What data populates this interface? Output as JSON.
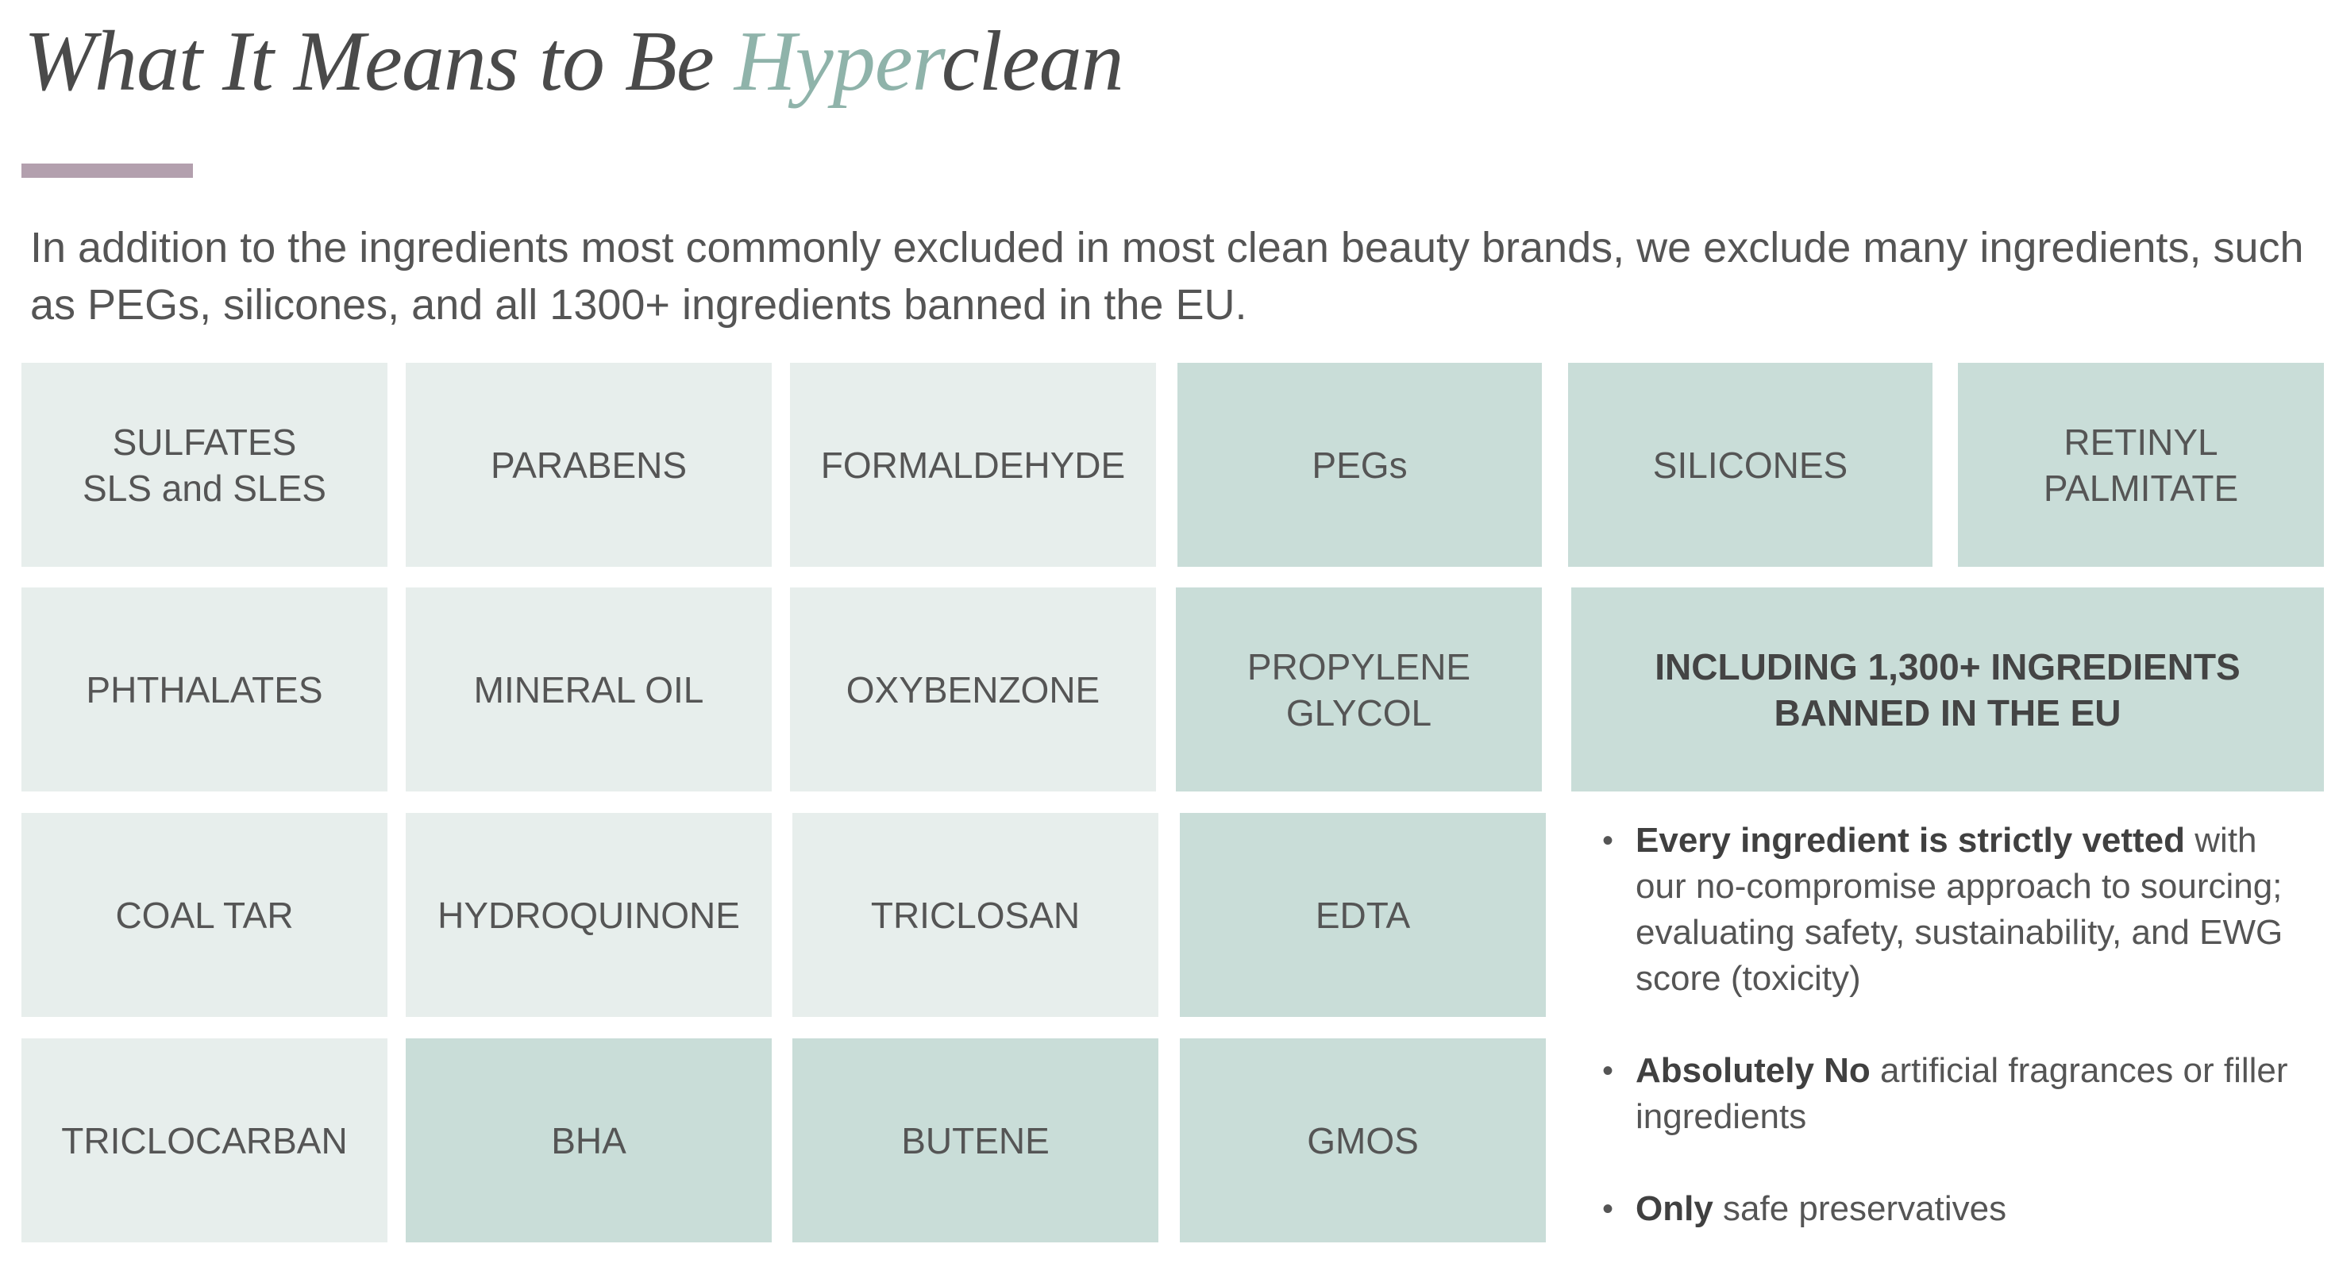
{
  "title": {
    "part1": "What It Means to Be ",
    "accent": "Hyper",
    "part2": "clean"
  },
  "intro": "In addition to the ingredients most commonly excluded in most clean beauty brands, we exclude many ingredients, such as PEGs, silicones, and all 1300+ ingredients banned in the EU.",
  "tiles": [
    {
      "label": "SULFATES\nSLS and SLES",
      "style": "light"
    },
    {
      "label": "PARABENS",
      "style": "light"
    },
    {
      "label": "FORMALDEHYDE",
      "style": "light"
    },
    {
      "label": "PEGs",
      "style": "dark"
    },
    {
      "label": "SILICONES",
      "style": "dark"
    },
    {
      "label": "RETINYL\nPALMITATE",
      "style": "dark"
    },
    {
      "label": "PHTHALATES",
      "style": "light"
    },
    {
      "label": "MINERAL OIL",
      "style": "light"
    },
    {
      "label": "OXYBENZONE",
      "style": "light"
    },
    {
      "label": "PROPYLENE\nGLYCOL",
      "style": "dark"
    },
    {
      "label": "INCLUDING 1,300+ INGREDIENTS\nBANNED IN THE EU",
      "style": "dark"
    },
    {
      "label": "COAL  TAR",
      "style": "light"
    },
    {
      "label": "HYDROQUINONE",
      "style": "light"
    },
    {
      "label": "TRICLOSAN",
      "style": "light"
    },
    {
      "label": "EDTA",
      "style": "dark"
    },
    {
      "label": "TRICLOCARBAN",
      "style": "light"
    },
    {
      "label": "BHA",
      "style": "dark"
    },
    {
      "label": "BUTENE",
      "style": "dark"
    },
    {
      "label": "GMOS",
      "style": "dark"
    }
  ],
  "bullets": [
    {
      "bold": "Every ingredient is strictly vetted",
      "text": " with our no-compromise approach to sourcing; evaluating safety, sustainability, and EWG score (toxicity)"
    },
    {
      "bold": "Absolutely No",
      "text": " artificial fragrances or filler ingredients"
    },
    {
      "bold": "Only",
      "text": " safe preservatives"
    }
  ],
  "bullet_glyph": "•",
  "colors": {
    "accent": "#8fb3aa",
    "rule": "#b3a0ae",
    "tile_light": "#e7eeec",
    "tile_dark": "#c9ddd8",
    "text": "#555555"
  }
}
